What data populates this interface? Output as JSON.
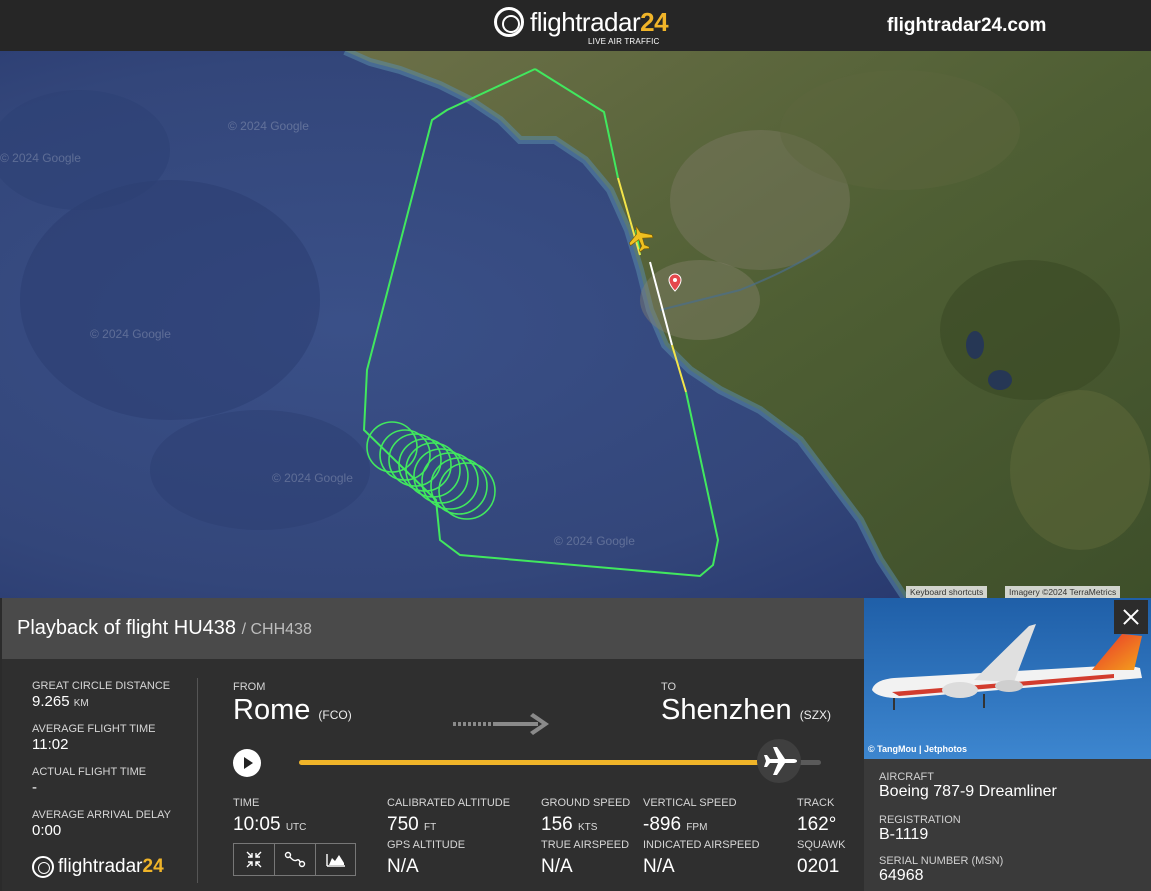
{
  "header": {
    "logo_text": "flightradar",
    "logo_num": "24",
    "logo_sub": "LIVE AIR TRAFFIC",
    "site": "flightradar24.com"
  },
  "map": {
    "watermark": "© 2024 Google",
    "keyboard_shortcuts": "Keyboard shortcuts",
    "imagery": "Imagery ©2024 TerraMetrics",
    "colors": {
      "sea": "#34497d",
      "land": "#4e5e33",
      "track_green": "#41e85e",
      "track_yellow": "#f3e44a"
    }
  },
  "playback": {
    "title_prefix": "Playback of flight",
    "flight": "HU438",
    "callsign": "/ CHH438"
  },
  "stats": [
    {
      "label": "GREAT CIRCLE DISTANCE",
      "value": "9.265",
      "unit": "KM"
    },
    {
      "label": "AVERAGE FLIGHT TIME",
      "value": "11:02",
      "unit": ""
    },
    {
      "label": "ACTUAL FLIGHT TIME",
      "value": "-",
      "unit": ""
    },
    {
      "label": "AVERAGE ARRIVAL DELAY",
      "value": "0:00",
      "unit": ""
    }
  ],
  "route": {
    "from_label": "FROM",
    "from_city": "Rome",
    "from_code": "(FCO)",
    "to_label": "TO",
    "to_city": "Shenzhen",
    "to_code": "(SZX)"
  },
  "progress": 0.92,
  "metrics": {
    "time": {
      "label": "TIME",
      "value": "10:05",
      "unit": "UTC"
    },
    "cal_alt": {
      "label": "CALIBRATED ALTITUDE",
      "value": "750",
      "unit": "FT"
    },
    "gps_alt": {
      "label": "GPS ALTITUDE",
      "value": "N/A"
    },
    "ground_speed": {
      "label": "GROUND SPEED",
      "value": "156",
      "unit": "KTS"
    },
    "true_airspeed": {
      "label": "TRUE AIRSPEED",
      "value": "N/A"
    },
    "vertical_speed": {
      "label": "VERTICAL SPEED",
      "value": "-896",
      "unit": "FPM"
    },
    "indicated_airspeed": {
      "label": "INDICATED AIRSPEED",
      "value": "N/A"
    },
    "track": {
      "label": "TRACK",
      "value": "162°"
    },
    "squawk": {
      "label": "SQUAWK",
      "value": "0201"
    }
  },
  "tools": [
    "collapse-icon",
    "route-icon",
    "chart-icon"
  ],
  "footer_logo": {
    "text": "flightradar",
    "num": "24"
  },
  "aircraft": {
    "photo_credit": "© TangMou | Jetphotos",
    "aircraft_label": "AIRCRAFT",
    "aircraft_value": "Boeing 787-9 Dreamliner",
    "registration_label": "REGISTRATION",
    "registration_value": "B-1119",
    "serial_label": "SERIAL NUMBER (MSN)",
    "serial_value": "64968"
  }
}
